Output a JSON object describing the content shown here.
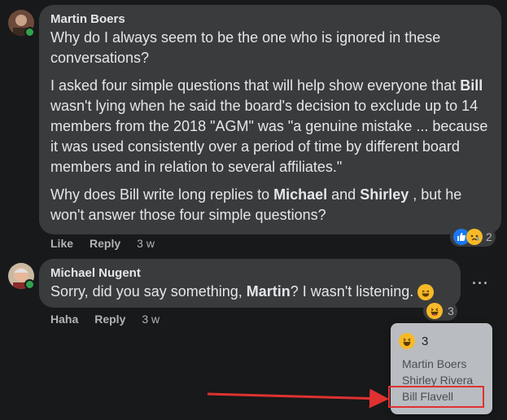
{
  "comments": [
    {
      "author": "Martin Boers",
      "p1": "Why do I always seem to be the one who is ignored in these conversations?",
      "p2_a": "I asked four simple questions that will help show everyone that ",
      "p2_b": "Bill",
      "p2_c": " wasn't lying when he said the board's decision to exclude up to 14 members from the 2018 \"AGM\" was \"a genuine mistake ... because it was used consistently over a period of time by different board members and in relation to several affiliates.\"",
      "p3_a": "Why does Bill write long replies to ",
      "p3_b": "Michael",
      "p3_c": " and ",
      "p3_d": "Shirley",
      "p3_e": " , but he won't answer those four simple questions?",
      "actions": {
        "like": "Like",
        "reply": "Reply",
        "time": "3 w"
      },
      "reaction_count": "2"
    },
    {
      "author": "Michael Nugent",
      "text_a": "Sorry, did you say something, ",
      "text_b": "Martin",
      "text_c": "? I wasn't listening. ",
      "actions": {
        "haha": "Haha",
        "reply": "Reply",
        "time": "3 w"
      },
      "reaction_count": "3",
      "more": "···"
    }
  ],
  "tooltip": {
    "count": "3",
    "names": [
      "Martin Boers",
      "Shirley Rivera",
      "Bill Flavell"
    ]
  },
  "colors": {
    "annotation": "#e03131",
    "like_blue": "#1877f2",
    "emoji_yellow": "#f7b928"
  }
}
